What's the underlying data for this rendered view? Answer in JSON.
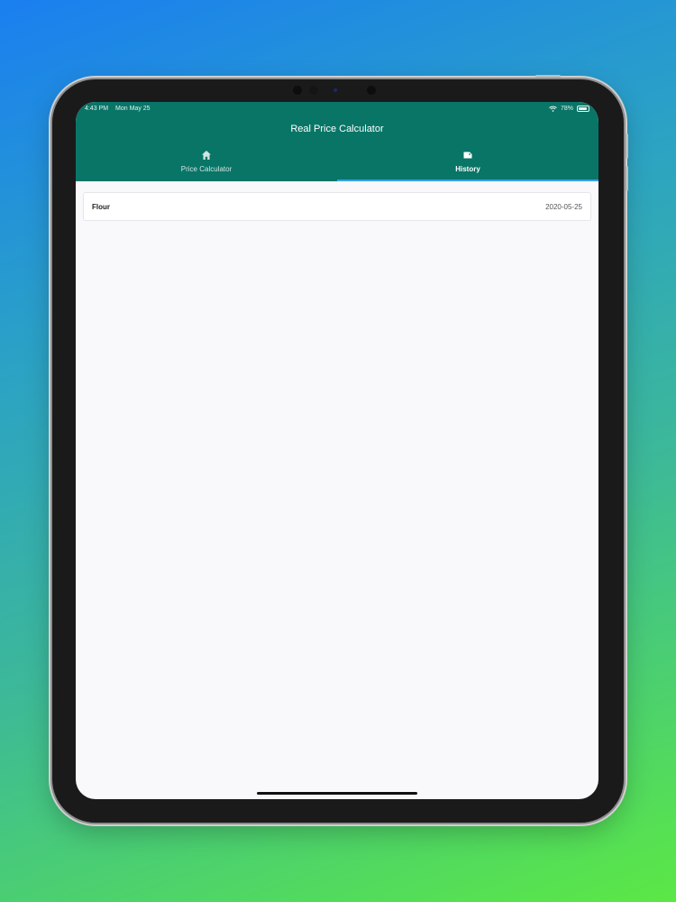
{
  "status_bar": {
    "time": "4:43 PM",
    "date": "Mon May 25",
    "battery": "78%"
  },
  "app": {
    "title": "Real Price Calculator"
  },
  "tabs": [
    {
      "label": "Price Calculator",
      "icon": "home-icon",
      "active": false
    },
    {
      "label": "History",
      "icon": "tag-icon",
      "active": true
    }
  ],
  "history": [
    {
      "name": "Flour",
      "date": "2020-05-25"
    }
  ],
  "colors": {
    "appbar": "#087567",
    "indicator": "#3aa0e8",
    "background": "#f9f8fb"
  }
}
